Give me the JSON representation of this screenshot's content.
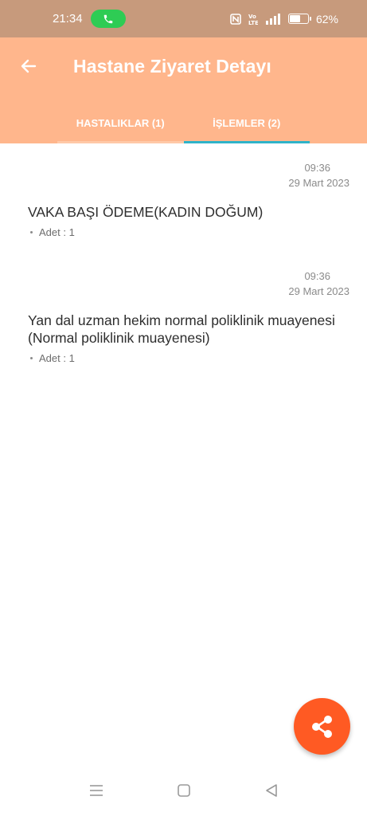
{
  "status_bar": {
    "time": "21:34",
    "battery_percent_label": "62%",
    "battery_level": 0.62,
    "icons": [
      "phone-call-icon",
      "nfc-icon",
      "volte-icon",
      "signal-icon",
      "battery-icon"
    ]
  },
  "app_bar": {
    "title": "Hastane Ziyaret Detayı",
    "back_icon": "arrow-left-icon",
    "background": "#ffb68c"
  },
  "tabs": [
    {
      "label": "HASTALIKLAR (1)",
      "active": false
    },
    {
      "label": "İŞLEMLER (2)",
      "active": true
    }
  ],
  "records": [
    {
      "time": "09:36",
      "date": "29 Mart 2023",
      "title": "VAKA BAŞI ÖDEME(KADIN DOĞUM)",
      "meta": "Adet : 1"
    },
    {
      "time": "09:36",
      "date": "29 Mart 2023",
      "title": "Yan dal uzman hekim normal poliklinik muayenesi (Normal poliklinik muayenesi)",
      "meta": "Adet : 1"
    }
  ],
  "fab": {
    "icon": "share-icon",
    "color": "#ff5a23"
  },
  "nav_bar": {
    "icons": [
      "menu-icon",
      "home-icon",
      "back-triangle-icon"
    ]
  }
}
